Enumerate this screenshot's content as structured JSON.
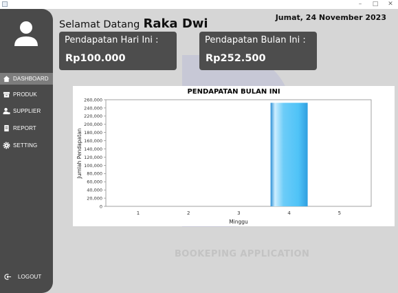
{
  "window": {
    "minimize": "–",
    "maximize": "□",
    "close": "✕"
  },
  "sidebar": {
    "avatar_icon": "user-avatar-icon",
    "items": [
      {
        "label": "DASHBOARD",
        "icon": "home-icon",
        "active": true
      },
      {
        "label": "PRODUK",
        "icon": "box-icon",
        "active": false
      },
      {
        "label": "SUPPLIER",
        "icon": "person-icon",
        "active": false
      },
      {
        "label": "REPORT",
        "icon": "document-icon",
        "active": false
      },
      {
        "label": "SETTING",
        "icon": "gear-icon",
        "active": false
      }
    ],
    "logout": {
      "label": "LOGOUT",
      "icon": "logout-icon"
    },
    "background_color": "#4a4a4a",
    "active_color": "#7d7d7d"
  },
  "header": {
    "greeting_prefix": "Selamat Datang",
    "user_name": "Raka Dwi",
    "date": "Jumat, 24 November 2023"
  },
  "cards": [
    {
      "title": "Pendapatan Hari Ini :",
      "value": "Rp100.000"
    },
    {
      "title": "Pendapatan Bulan Ini :",
      "value": "Rp252.500"
    }
  ],
  "app_caption": "BOOKEPING APPLICATION",
  "chart_data": {
    "type": "bar",
    "title": "PENDAPATAN BULAN INI",
    "xlabel": "Minggu",
    "ylabel": "Jumlah Pendapatan",
    "categories": [
      "1",
      "2",
      "3",
      "4",
      "5"
    ],
    "values": [
      0,
      0,
      0,
      252500,
      0
    ],
    "ylim": [
      0,
      260000
    ],
    "ytick_step": 20000,
    "yticks": [
      "0",
      "20,000",
      "40,000",
      "60,000",
      "80,000",
      "100,000",
      "120,000",
      "140,000",
      "160,000",
      "180,000",
      "200,000",
      "220,000",
      "240,000",
      "260,000"
    ],
    "grid": false,
    "bar_color": "#4fc3f7"
  }
}
